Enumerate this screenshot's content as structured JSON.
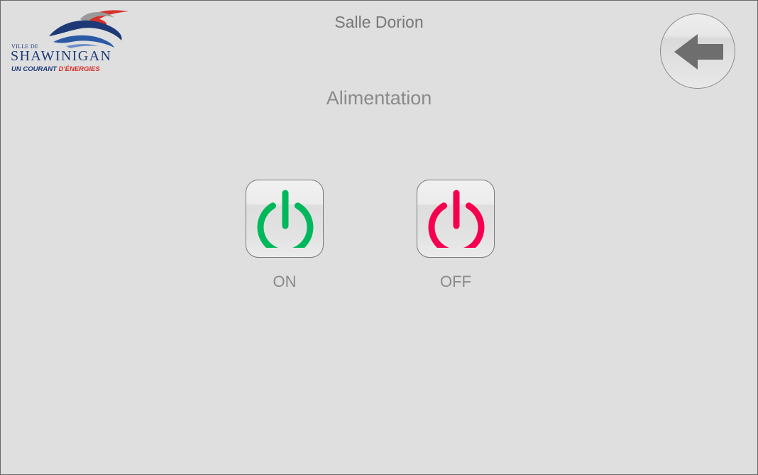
{
  "header": {
    "title": "Salle Dorion",
    "back_icon": "arrow-left-icon"
  },
  "logo": {
    "ville": "VILLE DE",
    "city": "SHAWINIGAN",
    "tagline_part1": "UN COURANT",
    "tagline_part2": "D'ÉNERGIES"
  },
  "main": {
    "section_title": "Alimentation",
    "buttons": [
      {
        "label": "ON",
        "icon": "power-icon",
        "color": "#00b85c"
      },
      {
        "label": "OFF",
        "icon": "power-icon",
        "color": "#f5004f"
      }
    ]
  },
  "colors": {
    "background": "#dfdfdf",
    "text": "#8a8a8a",
    "on": "#00b85c",
    "off": "#f5004f",
    "arrow": "#6e6e6e"
  }
}
